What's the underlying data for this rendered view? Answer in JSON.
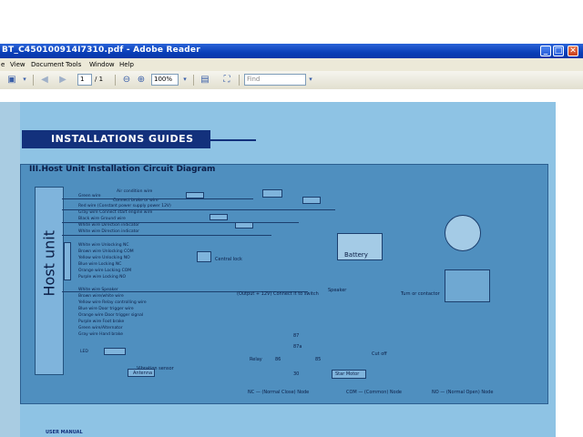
{
  "window": {
    "title": "BT_C450100914I7310.pdf - Adobe Reader",
    "buttons": {
      "minimize": "_",
      "maximize": "□",
      "close": "✕"
    }
  },
  "menu": [
    "e",
    "View",
    "Document",
    "Tools",
    "Window",
    "Help"
  ],
  "toolbar": {
    "page_current": "1",
    "page_total": "/ 1",
    "zoom": "100%",
    "find_placeholder": "Find"
  },
  "document": {
    "banner": "INSTALLATIONS GUIDES",
    "diagram_title": "III.Host Unit Installation Circuit Diagram",
    "host_label": "Host unit",
    "wires_group1": [
      "Air condition wire",
      "Green wire",
      "Connect brake or wire",
      "Red wire (Constant power supply power 12V)",
      "Gray wire Connect start engine wire",
      "Black wire Ground wire",
      "White wire Direction indicator",
      "White wire Direction indicator"
    ],
    "wires_group2": [
      "White wire Unlocking NC",
      "Brown wire Unlocking COM",
      "Yellow wire Unlocking NO",
      "Blue wire Locking NC",
      "Orange wire Locking COM",
      "Purple wire Locking NO"
    ],
    "wires_group3": [
      "White wire Speaker",
      "Brown wire/white wire",
      "Yellow wire Relay controlling wire",
      "Blue wire Door trigger wire",
      "Orange wire Door trigger signal",
      "Purple wire Foot brake",
      "Green wire/Alternator",
      "Gray wire Hand brake"
    ],
    "labels": {
      "battery": "Battery",
      "central_lock": "Central lock",
      "speaker": "Speaker",
      "turn_or_contactor": "Turn or contactor",
      "led": "LED",
      "antenna": "Antenna",
      "vibration_sensor": "Vibration sensor",
      "relay": "Relay",
      "cut_off": "Cut off",
      "starter_motor": "Star Motor",
      "output_note": "(Output + 12V) Connect it to switch",
      "nc_note": "NC — (Normal Close) Node",
      "com_note": "COM — (Common) Node",
      "no_note": "NO — (Normal Open) Node",
      "pin_87": "87",
      "pin_87a": "87a",
      "pin_86": "86",
      "pin_85": "85",
      "pin_30": "30"
    },
    "footer": "USER MANUAL"
  },
  "colors": {
    "page_blue": "#8ec3e4",
    "banner_navy": "#13317c",
    "titlebar": "#0a3fb8"
  }
}
